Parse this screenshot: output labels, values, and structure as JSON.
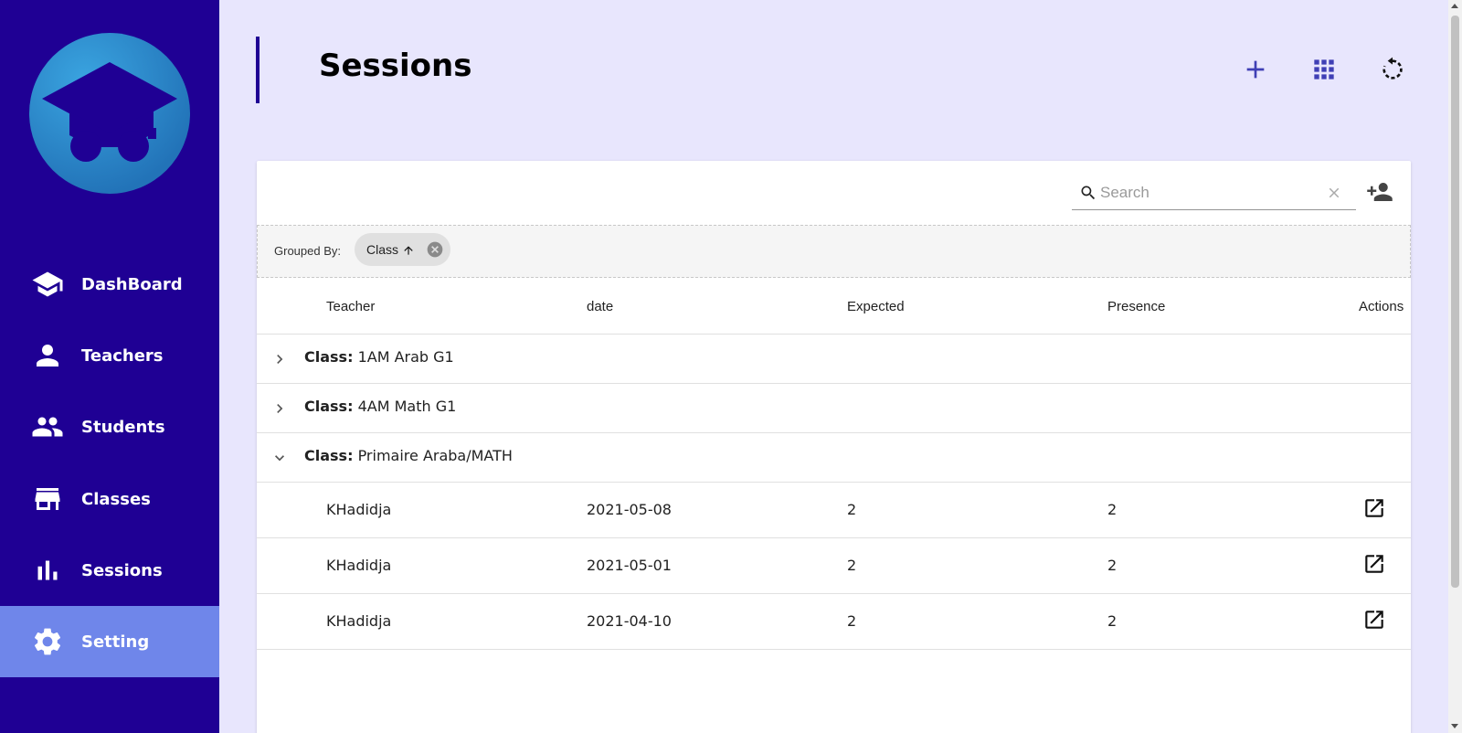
{
  "sidebar": {
    "items": [
      {
        "label": "DashBoard",
        "icon": "school-icon"
      },
      {
        "label": "Teachers",
        "icon": "person-icon"
      },
      {
        "label": "Students",
        "icon": "people-icon"
      },
      {
        "label": "Classes",
        "icon": "store-icon"
      },
      {
        "label": "Sessions",
        "icon": "bar-chart-icon"
      },
      {
        "label": "Setting",
        "icon": "gear-icon",
        "active": true
      }
    ]
  },
  "header": {
    "title": "Sessions",
    "actions": [
      "add-icon",
      "grid-icon",
      "refresh-icon"
    ]
  },
  "toolbar": {
    "search_placeholder": "Search",
    "search_value": ""
  },
  "grouping": {
    "label": "Grouped By:",
    "chip_label": "Class"
  },
  "table": {
    "columns": [
      "Teacher",
      "date",
      "Expected",
      "Presence",
      "Actions"
    ],
    "groups": [
      {
        "key": "Class:",
        "value": "1AM Arab G1",
        "expanded": false
      },
      {
        "key": "Class:",
        "value": "4AM Math G1",
        "expanded": false
      },
      {
        "key": "Class:",
        "value": "Primaire Araba/MATH",
        "expanded": true
      }
    ],
    "rows": [
      {
        "teacher": "KHadidja",
        "date": "2021-05-08",
        "expected": "2",
        "presence": "2"
      },
      {
        "teacher": "KHadidja",
        "date": "2021-05-01",
        "expected": "2",
        "presence": "2"
      },
      {
        "teacher": "KHadidja",
        "date": "2021-04-10",
        "expected": "2",
        "presence": "2"
      }
    ]
  },
  "colors": {
    "sidebar_bg": "#1f0094",
    "active_item": "#6f86ea",
    "page_bg": "#e8e6fd",
    "accent_icon": "#3f3fb5"
  }
}
